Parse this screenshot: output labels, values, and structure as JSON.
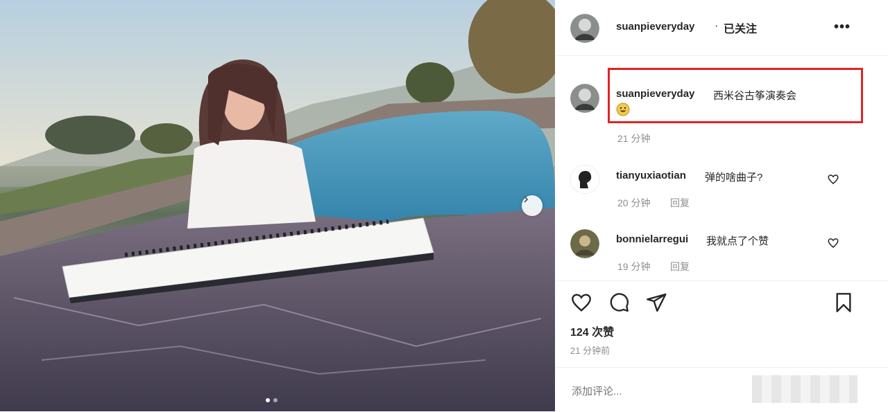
{
  "post": {
    "author": "suanpieveryday",
    "separator": "·",
    "follow_status": "已关注",
    "more_icon": "more-horizontal-icon"
  },
  "caption": {
    "author": "suanpieveryday",
    "text": "西米谷古筝演奏会",
    "time": "21 分钟"
  },
  "comments": [
    {
      "user": "tianyuxiaotian",
      "text": "弹的啥曲子?",
      "time": "20 分钟",
      "reply": "回复"
    },
    {
      "user": "bonnielarregui",
      "text": "我就点了个赞",
      "time": "19 分钟",
      "reply": "回复"
    }
  ],
  "actions": {
    "icons": [
      "heart-icon",
      "comment-icon",
      "share-icon",
      "bookmark-icon"
    ],
    "likes": "124 次赞",
    "posted": "21 分钟前"
  },
  "add_comment": {
    "placeholder": "添加评论..."
  },
  "carousel": {
    "current_index": 1,
    "total": 2
  },
  "colors": {
    "highlight_border": "#e02424",
    "text_primary": "#262626",
    "text_secondary": "#8e8e8e"
  }
}
